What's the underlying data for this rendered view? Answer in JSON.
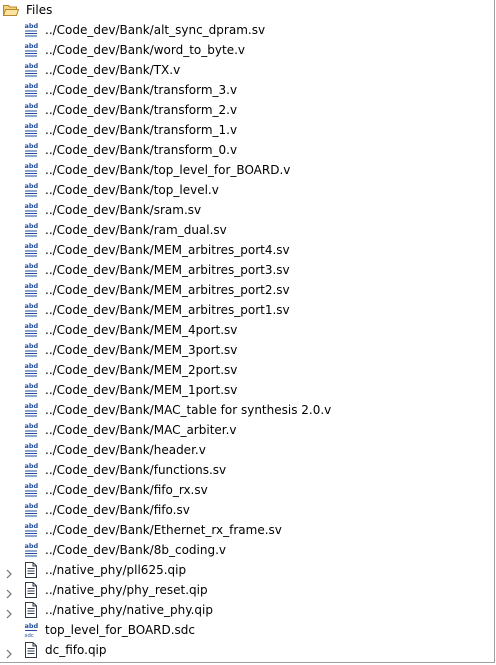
{
  "tree": {
    "root": {
      "label": "Files",
      "icon": "folder-open-icon"
    },
    "items": [
      {
        "label": "../Code_dev/Bank/alt_sync_dpram.sv",
        "icon": "verilog-file-icon",
        "expandable": false
      },
      {
        "label": "../Code_dev/Bank/word_to_byte.v",
        "icon": "verilog-file-icon",
        "expandable": false
      },
      {
        "label": "../Code_dev/Bank/TX.v",
        "icon": "verilog-file-icon",
        "expandable": false
      },
      {
        "label": "../Code_dev/Bank/transform_3.v",
        "icon": "verilog-file-icon",
        "expandable": false
      },
      {
        "label": "../Code_dev/Bank/transform_2.v",
        "icon": "verilog-file-icon",
        "expandable": false
      },
      {
        "label": "../Code_dev/Bank/transform_1.v",
        "icon": "verilog-file-icon",
        "expandable": false
      },
      {
        "label": "../Code_dev/Bank/transform_0.v",
        "icon": "verilog-file-icon",
        "expandable": false
      },
      {
        "label": "../Code_dev/Bank/top_level_for_BOARD.v",
        "icon": "verilog-file-icon",
        "expandable": false
      },
      {
        "label": "../Code_dev/Bank/top_level.v",
        "icon": "verilog-file-icon",
        "expandable": false
      },
      {
        "label": "../Code_dev/Bank/sram.sv",
        "icon": "verilog-file-icon",
        "expandable": false
      },
      {
        "label": "../Code_dev/Bank/ram_dual.sv",
        "icon": "verilog-file-icon",
        "expandable": false
      },
      {
        "label": "../Code_dev/Bank/MEM_arbitres_port4.sv",
        "icon": "verilog-file-icon",
        "expandable": false
      },
      {
        "label": "../Code_dev/Bank/MEM_arbitres_port3.sv",
        "icon": "verilog-file-icon",
        "expandable": false
      },
      {
        "label": "../Code_dev/Bank/MEM_arbitres_port2.sv",
        "icon": "verilog-file-icon",
        "expandable": false
      },
      {
        "label": "../Code_dev/Bank/MEM_arbitres_port1.sv",
        "icon": "verilog-file-icon",
        "expandable": false
      },
      {
        "label": "../Code_dev/Bank/MEM_4port.sv",
        "icon": "verilog-file-icon",
        "expandable": false
      },
      {
        "label": "../Code_dev/Bank/MEM_3port.sv",
        "icon": "verilog-file-icon",
        "expandable": false
      },
      {
        "label": "../Code_dev/Bank/MEM_2port.sv",
        "icon": "verilog-file-icon",
        "expandable": false
      },
      {
        "label": "../Code_dev/Bank/MEM_1port.sv",
        "icon": "verilog-file-icon",
        "expandable": false
      },
      {
        "label": "../Code_dev/Bank/MAC_table for synthesis 2.0.v",
        "icon": "verilog-file-icon",
        "expandable": false
      },
      {
        "label": "../Code_dev/Bank/MAC_arbiter.v",
        "icon": "verilog-file-icon",
        "expandable": false
      },
      {
        "label": "../Code_dev/Bank/header.v",
        "icon": "verilog-file-icon",
        "expandable": false
      },
      {
        "label": "../Code_dev/Bank/functions.sv",
        "icon": "verilog-file-icon",
        "expandable": false
      },
      {
        "label": "../Code_dev/Bank/fifo_rx.sv",
        "icon": "verilog-file-icon",
        "expandable": false
      },
      {
        "label": "../Code_dev/Bank/fifo.sv",
        "icon": "verilog-file-icon",
        "expandable": false
      },
      {
        "label": "../Code_dev/Bank/Ethernet_rx_frame.sv",
        "icon": "verilog-file-icon",
        "expandable": false
      },
      {
        "label": "../Code_dev/Bank/8b_coding.v",
        "icon": "verilog-file-icon",
        "expandable": false
      },
      {
        "label": "../native_phy/pll625.qip",
        "icon": "qip-file-icon",
        "expandable": true
      },
      {
        "label": "../native_phy/phy_reset.qip",
        "icon": "qip-file-icon",
        "expandable": true
      },
      {
        "label": "../native_phy/native_phy.qip",
        "icon": "qip-file-icon",
        "expandable": true
      },
      {
        "label": "top_level_for_BOARD.sdc",
        "icon": "sdc-file-icon",
        "expandable": false
      },
      {
        "label": "dc_fifo.qip",
        "icon": "qip-file-icon",
        "expandable": true
      }
    ]
  },
  "colors": {
    "icon_blue": "#1f4e9c",
    "folder_yellow": "#f0c24a",
    "expander_gray": "#707070"
  }
}
